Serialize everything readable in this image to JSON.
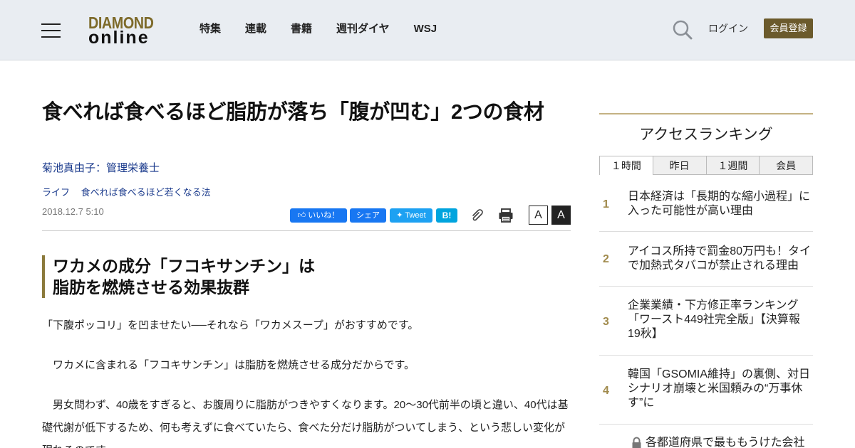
{
  "header": {
    "logo_line1": "DIAMOND",
    "logo_line2": "online",
    "nav": [
      "特集",
      "連載",
      "書籍",
      "週刊ダイヤ",
      "WSJ"
    ],
    "login": "ログイン",
    "register": "会員登録"
  },
  "article": {
    "title": "食べれば食べるほど脂肪が落ち「腹が凹む」2つの食材",
    "author": "菊池真由子：管理栄養士",
    "categories": [
      "ライフ",
      "食べれば食べるほど若くなる法"
    ],
    "date": "2018.12.7 5:10",
    "share": {
      "like": "いいね！",
      "share": "シェア",
      "tweet": "Tweet",
      "hatena": "B!"
    },
    "font_small": "A",
    "font_large": "A",
    "subhead_line1": "ワカメの成分「フコキサンチン」は",
    "subhead_line2": "脂肪を燃焼させる効果抜群",
    "paragraphs": [
      "「下腹ポッコリ」を凹ませたい──それなら「ワカメスープ」がおすすめです。",
      "　ワカメに含まれる「フコキサンチン」は脂肪を燃焼させる成分だからです。",
      "　男女問わず、40歳をすぎると、お腹周りに脂肪がつきやすくなります。20～30代前半の頃と違い、40代は基礎代謝が低下するため、何も考えずに食べていたら、食べた分だけ脂肪がついてしまう、という悲しい変化が現れるのです。"
    ]
  },
  "ranking": {
    "title": "アクセスランキング",
    "tabs": [
      "１時間",
      "昨日",
      "１週間",
      "会員"
    ],
    "active_tab": "１時間",
    "items": [
      {
        "num": "1",
        "text": "日本経済は「長期的な縮小過程」に入った可能性が高い理由"
      },
      {
        "num": "2",
        "text": "アイコス所持で罰金80万円も！タイで加熱式タバコが禁止される理由"
      },
      {
        "num": "3",
        "text": "企業業績・下方修正率ランキング「ワースト449社完全版」【決算報19秋】"
      },
      {
        "num": "4",
        "text": "韓国「GSOMIA維持」の裏側、対日シナリオ崩壊と米国頼みの“万事休す”に"
      },
      {
        "num": "5",
        "text": "各都道府県で最ももうけた会社"
      }
    ]
  },
  "colors": {
    "accent": "#6b5a2c",
    "link": "#1a3a8c",
    "rank_num": "#a08a4c",
    "header_bg": "#e9edf2"
  },
  "icons": [
    "menu-icon",
    "search-icon",
    "clip-icon",
    "print-icon",
    "lock-icon"
  ]
}
